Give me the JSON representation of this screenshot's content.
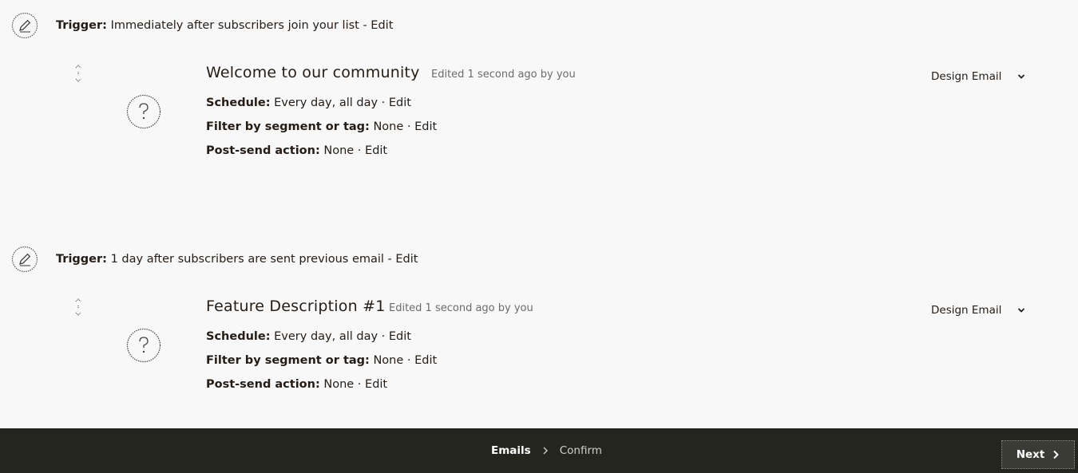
{
  "steps": [
    {
      "trigger": {
        "label": "Trigger:",
        "text": "Immediately after subscribers join your list",
        "separator": " - ",
        "edit": "Edit"
      },
      "email": {
        "title": "Welcome to our community",
        "meta": "Edited 1 second ago by you",
        "design_label": "Design Email",
        "schedule_label": "Schedule:",
        "schedule_value": "Every day, all day",
        "filter_label": "Filter by segment or tag:",
        "filter_value": "None",
        "postsend_label": "Post-send action:",
        "postsend_value": "None",
        "dot": " · ",
        "edit": "Edit"
      }
    },
    {
      "trigger": {
        "label": "Trigger:",
        "text": "1 day after subscribers are sent previous email",
        "separator": " - ",
        "edit": "Edit"
      },
      "email": {
        "title": "Feature Description #1",
        "meta": "Edited 1 second ago by you",
        "design_label": "Design Email",
        "schedule_label": "Schedule:",
        "schedule_value": "Every day, all day",
        "filter_label": "Filter by segment or tag:",
        "filter_value": "None",
        "postsend_label": "Post-send action:",
        "postsend_value": "None",
        "dot": " · ",
        "edit": "Edit"
      }
    }
  ],
  "footer": {
    "crumb_current": "Emails",
    "crumb_next": "Confirm",
    "next_label": "Next"
  },
  "icons": {
    "trigger": "pencil-circle-icon",
    "placeholder": "question-circle-icon",
    "drag": "drag-handle-icon",
    "dropdown": "chevron-down-icon",
    "crumb_sep": "chevron-right-icon",
    "next": "chevron-right-icon"
  },
  "colors": {
    "background": "#f8f8f8",
    "text": "#241c15",
    "footer": "#252520"
  }
}
